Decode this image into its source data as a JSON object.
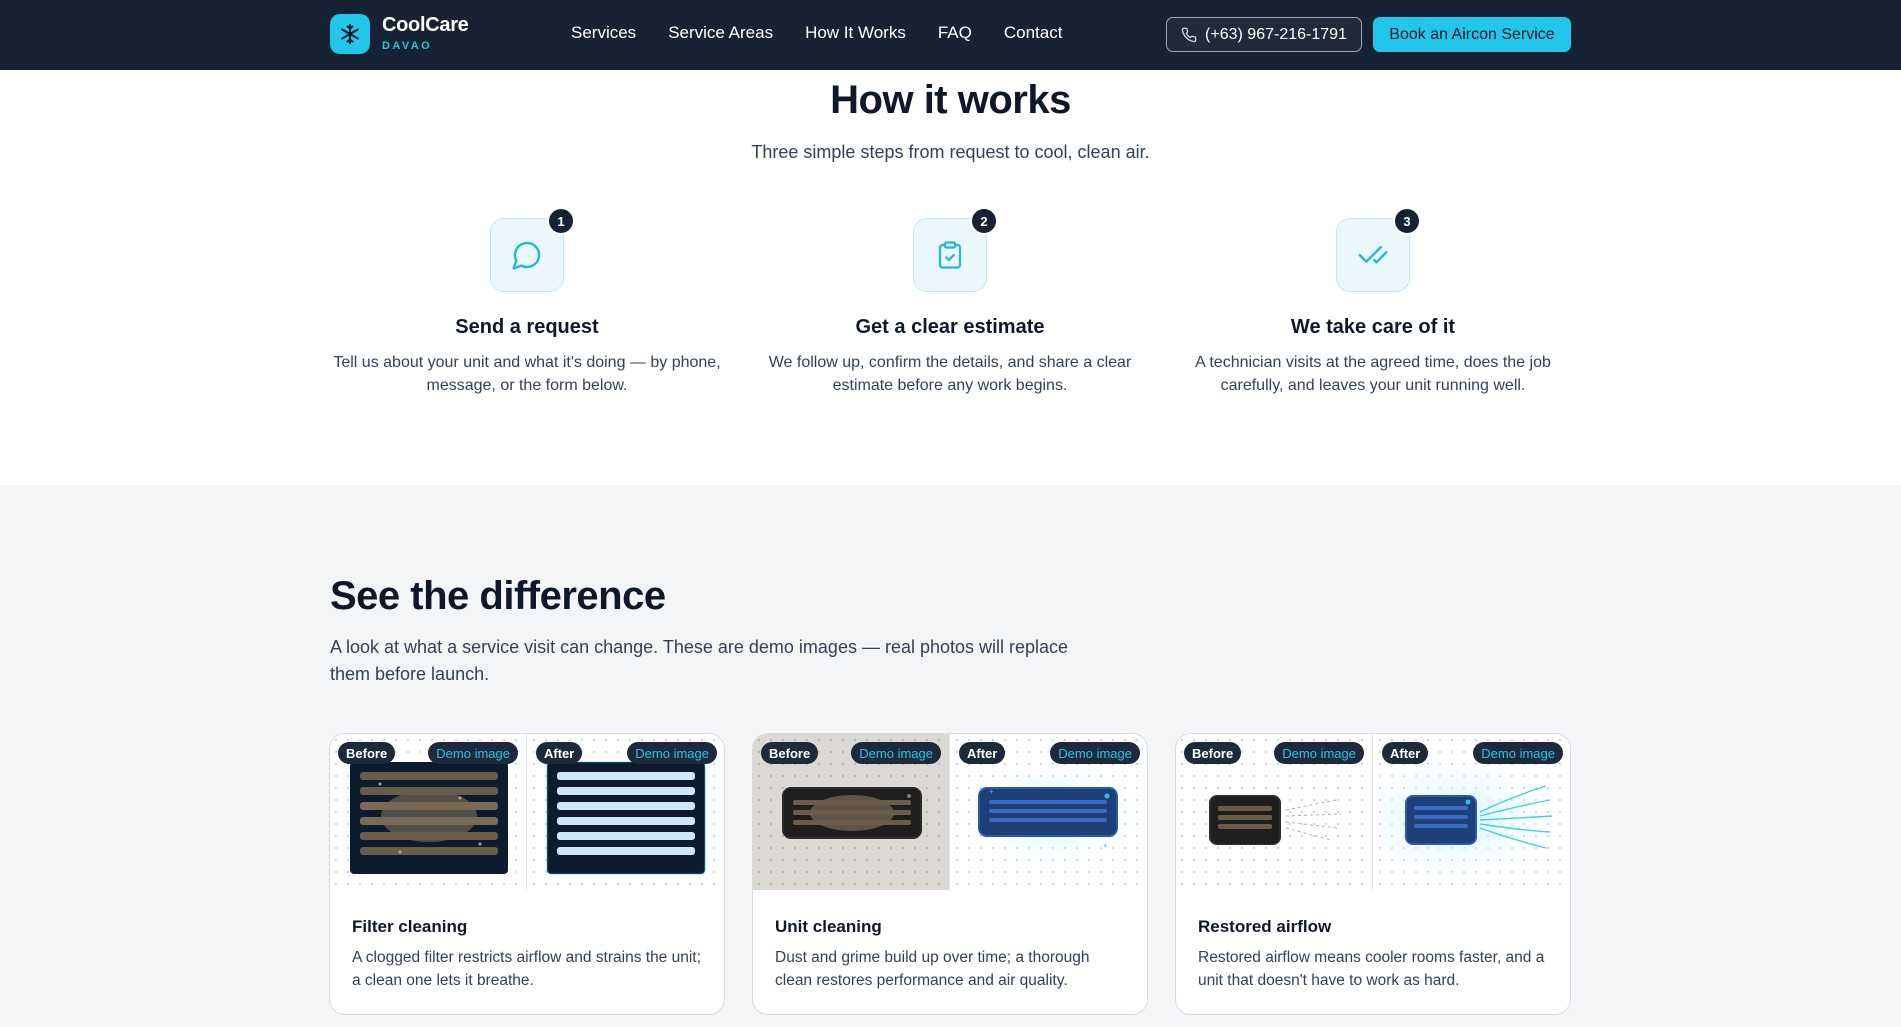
{
  "header": {
    "brand_name": "CoolCare",
    "brand_sub": "DAVAO",
    "nav": [
      "Services",
      "Service Areas",
      "How It Works",
      "FAQ",
      "Contact"
    ],
    "phone": "(+63) 967-216-1791",
    "book_label": "Book an Aircon Service"
  },
  "how_it_works": {
    "title": "How it works",
    "subtitle": "Three simple steps from request to cool, clean air.",
    "steps": [
      {
        "num": "1",
        "title": "Send a request",
        "desc": "Tell us about your unit and what it's doing — by phone, message, or the form below.",
        "icon": "chat-bubble-icon"
      },
      {
        "num": "2",
        "title": "Get a clear estimate",
        "desc": "We follow up, confirm the details, and share a clear estimate before any work begins.",
        "icon": "clipboard-check-icon"
      },
      {
        "num": "3",
        "title": "We take care of it",
        "desc": "A technician visits at the agreed time, does the job carefully, and leaves your unit running well.",
        "icon": "double-check-icon"
      }
    ]
  },
  "difference": {
    "title": "See the difference",
    "subtitle": "A look at what a service visit can change. These are demo images — real photos will replace them before launch.",
    "before_label": "Before",
    "after_label": "After",
    "demo_label": "Demo image",
    "cards": [
      {
        "title": "Filter cleaning",
        "desc": "A clogged filter restricts airflow and strains the unit; a clean one lets it breathe."
      },
      {
        "title": "Unit cleaning",
        "desc": "Dust and grime build up over time; a thorough clean restores performance and air quality."
      },
      {
        "title": "Restored airflow",
        "desc": "Restored airflow means cooler rooms faster, and a unit that doesn't have to work as hard."
      }
    ]
  },
  "colors": {
    "header_bg": "#172234",
    "accent": "#22c6e8",
    "section_gray": "#f4f5f7"
  }
}
